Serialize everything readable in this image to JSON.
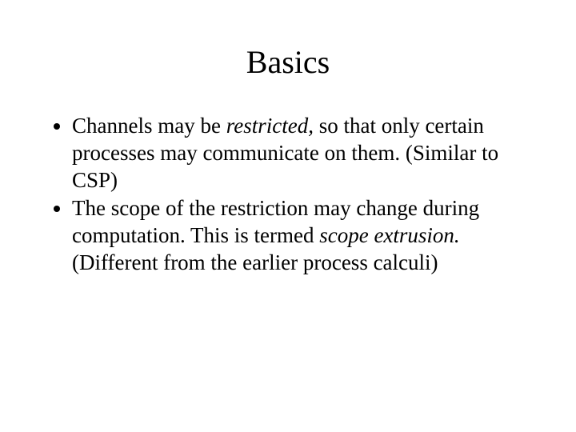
{
  "slide": {
    "title": "Basics",
    "bullets": [
      {
        "t1": "Channels may be ",
        "em1": "restricted,",
        "t2": " so that only certain processes may communicate on them. (Similar to CSP)",
        "em2": "",
        "t3": ""
      },
      {
        "t1": "The scope of the restriction may change during computation. This is termed ",
        "em1": "scope extrusion.",
        "t2": " (Different from the earlier process calculi)",
        "em2": "",
        "t3": ""
      }
    ]
  }
}
